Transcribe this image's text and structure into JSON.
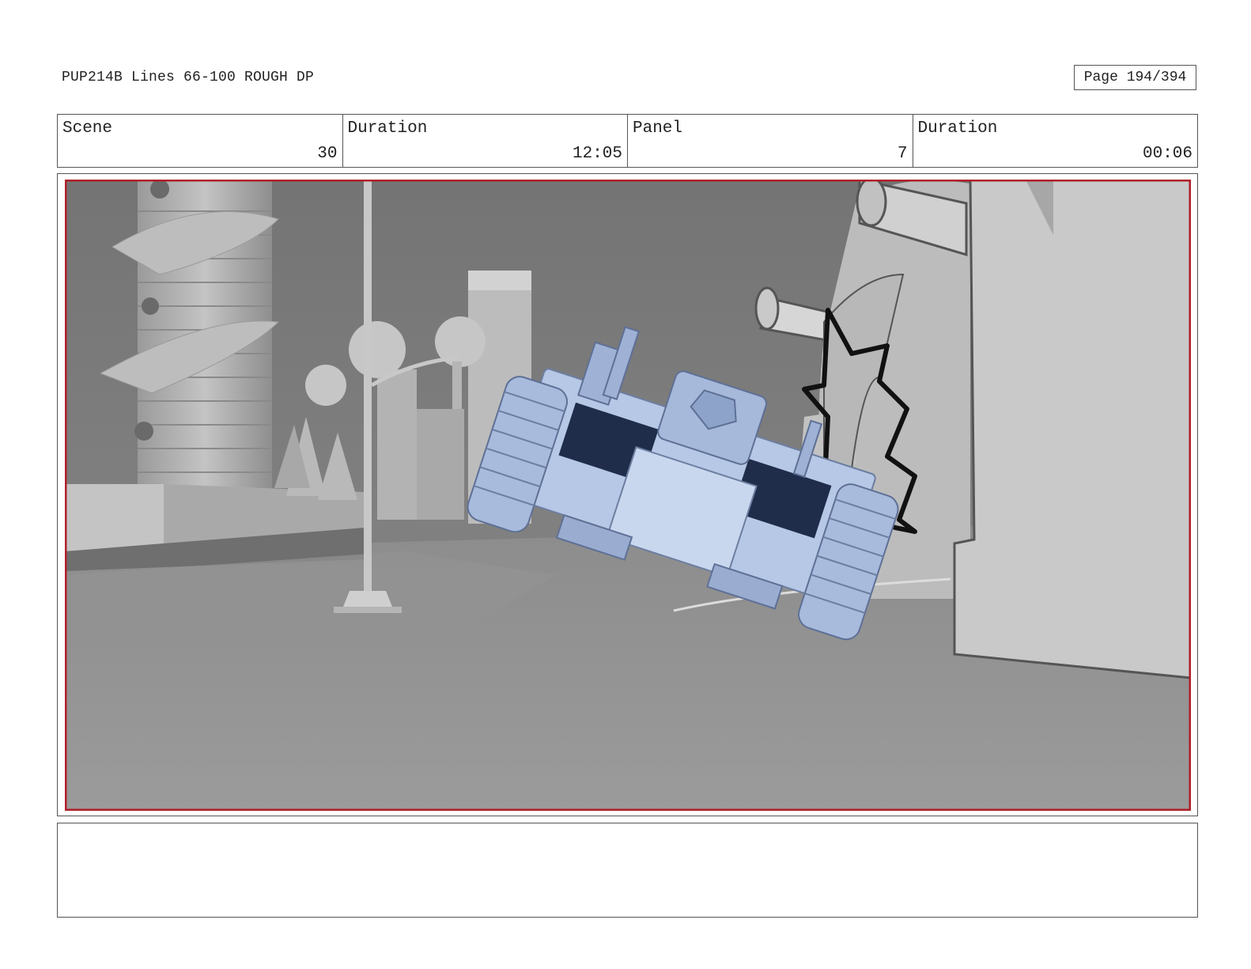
{
  "header": {
    "document_title": "PUP214B Lines 66-100 ROUGH DP",
    "page_label": "Page 194/394"
  },
  "info": [
    {
      "label": "Scene",
      "value": "30"
    },
    {
      "label": "Duration",
      "value": "12:05"
    },
    {
      "label": "Panel",
      "value": "7"
    },
    {
      "label": "Duration",
      "value": "00:06"
    }
  ],
  "panel": {
    "frame_color": "#b01f2a",
    "vehicle_color": "#b7c8e6",
    "background_color": "#8f8f8f"
  },
  "notes": {
    "text": ""
  }
}
